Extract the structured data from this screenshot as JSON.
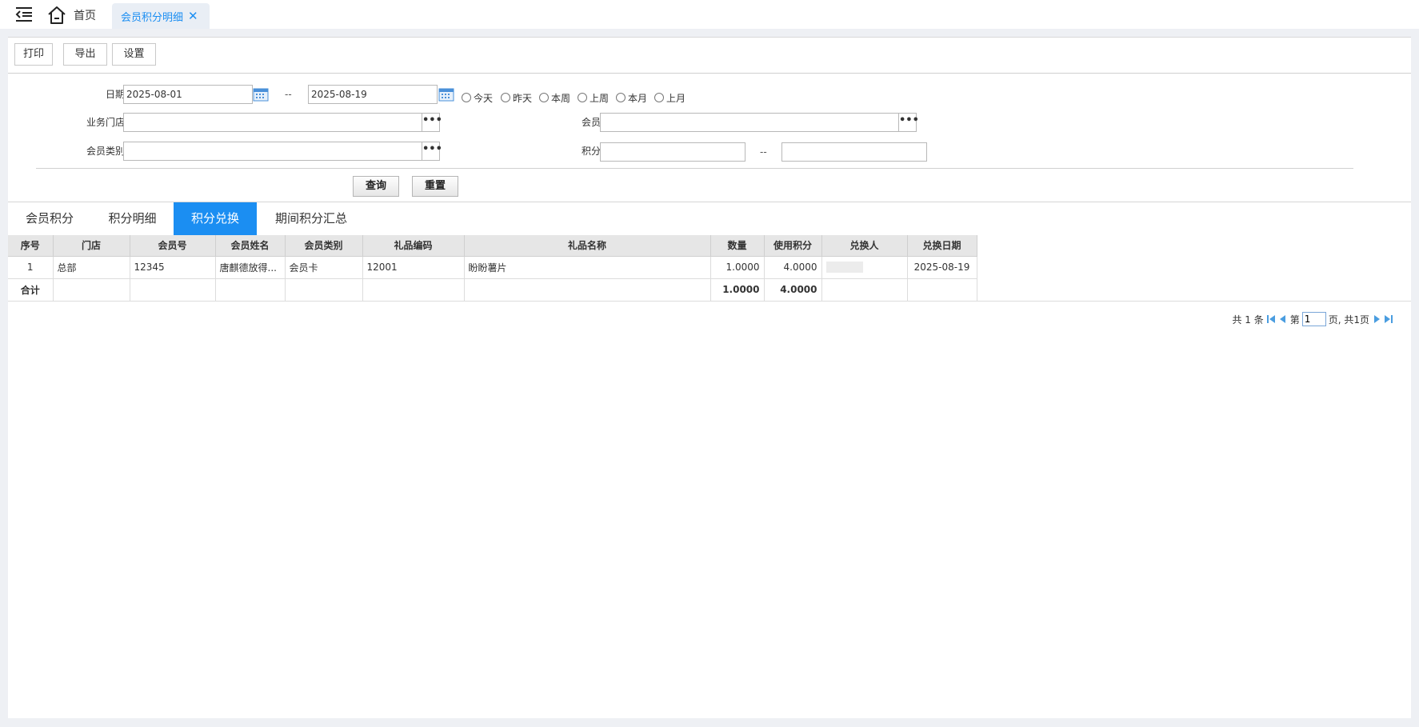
{
  "tabs": {
    "home_label": "首页",
    "active_label": "会员积分明细"
  },
  "toolbar": {
    "print": "打印",
    "export": "导出",
    "settings": "设置"
  },
  "filters": {
    "date_label": "日期:",
    "date_from": "2025-08-01",
    "date_to": "2025-08-19",
    "range_sep": "--",
    "quick_ranges": [
      "今天",
      "昨天",
      "本周",
      "上周",
      "本月",
      "上月"
    ],
    "store_label": "业务门店:",
    "store_value": "",
    "member_label": "会员:",
    "member_value": "",
    "member_type_label": "会员类别:",
    "member_type_value": "",
    "points_label": "积分:",
    "points_from": "",
    "points_to": "",
    "dots": "•••",
    "query": "查询",
    "reset": "重置"
  },
  "section_tabs": [
    "会员积分",
    "积分明细",
    "积分兑换",
    "期间积分汇总"
  ],
  "active_section": "积分兑换",
  "grid": {
    "columns": [
      "序号",
      "门店",
      "会员号",
      "会员姓名",
      "会员类别",
      "礼品编码",
      "礼品名称",
      "数量",
      "使用积分",
      "兑换人",
      "兑换日期"
    ],
    "rows": [
      {
        "no": "1",
        "store": "总部",
        "member_no": "12345",
        "member_name": "唐麒德放得...",
        "member_type": "会员卡",
        "gift_code": "12001",
        "gift_name": "盼盼薯片",
        "qty": "1.0000",
        "points": "4.0000",
        "redeemer": "",
        "date": "2025-08-19"
      }
    ],
    "total": {
      "label": "合计",
      "qty": "1.0000",
      "points": "4.0000"
    }
  },
  "pager": {
    "total_text": "共 1 条",
    "page_prefix": "第",
    "page_value": "1",
    "page_suffix": "页, 共1页"
  }
}
